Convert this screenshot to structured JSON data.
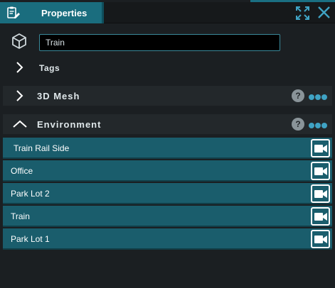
{
  "window": {
    "tab_title": "Properties",
    "tab_icon": "clipboard-edit-icon",
    "expand_icon": "expand-icon",
    "close_icon": "close-icon"
  },
  "object": {
    "icon": "cube-icon",
    "name_value": "Train"
  },
  "tags": {
    "label": "Tags",
    "icon": "chevron-right-icon"
  },
  "sections": {
    "mesh": {
      "label": "3D Mesh",
      "icon": "chevron-right-icon",
      "help": "?",
      "more": "more-icon"
    },
    "environment": {
      "label": "Environment",
      "icon": "chevron-up-icon",
      "help": "?",
      "more": "more-icon"
    }
  },
  "environment_items": [
    {
      "label": "Train Rail Side",
      "icon": "camera-icon"
    },
    {
      "label": "Office",
      "icon": "camera-icon"
    },
    {
      "label": "Park Lot 2",
      "icon": "camera-icon"
    },
    {
      "label": "Train",
      "icon": "camera-icon"
    },
    {
      "label": "Park Lot 1",
      "icon": "camera-icon"
    }
  ],
  "colors": {
    "accent": "#1a6d7e",
    "list_item": "#1a5d6c",
    "background": "#1b1f22",
    "dots": "#3fa3c4"
  }
}
